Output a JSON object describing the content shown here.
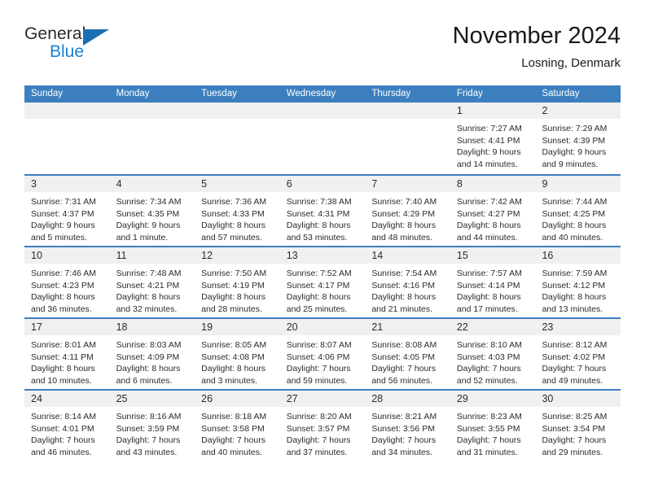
{
  "brand": {
    "name_part1": "General",
    "name_part2": "Blue"
  },
  "header": {
    "title": "November 2024",
    "subtitle": "Losning, Denmark"
  },
  "colors": {
    "header_blue": "#3c7fbe",
    "logo_blue": "#1b7fd4",
    "logo_triangle": "#1b6fb3",
    "day_band_gray": "#f0f0f0",
    "text": "#2b2b2b"
  },
  "weekdays": [
    "Sunday",
    "Monday",
    "Tuesday",
    "Wednesday",
    "Thursday",
    "Friday",
    "Saturday"
  ],
  "weeks": [
    [
      {
        "day": "",
        "lines": []
      },
      {
        "day": "",
        "lines": []
      },
      {
        "day": "",
        "lines": []
      },
      {
        "day": "",
        "lines": []
      },
      {
        "day": "",
        "lines": []
      },
      {
        "day": "1",
        "lines": [
          "Sunrise: 7:27 AM",
          "Sunset: 4:41 PM",
          "Daylight: 9 hours",
          "and 14 minutes."
        ]
      },
      {
        "day": "2",
        "lines": [
          "Sunrise: 7:29 AM",
          "Sunset: 4:39 PM",
          "Daylight: 9 hours",
          "and 9 minutes."
        ]
      }
    ],
    [
      {
        "day": "3",
        "lines": [
          "Sunrise: 7:31 AM",
          "Sunset: 4:37 PM",
          "Daylight: 9 hours",
          "and 5 minutes."
        ]
      },
      {
        "day": "4",
        "lines": [
          "Sunrise: 7:34 AM",
          "Sunset: 4:35 PM",
          "Daylight: 9 hours",
          "and 1 minute."
        ]
      },
      {
        "day": "5",
        "lines": [
          "Sunrise: 7:36 AM",
          "Sunset: 4:33 PM",
          "Daylight: 8 hours",
          "and 57 minutes."
        ]
      },
      {
        "day": "6",
        "lines": [
          "Sunrise: 7:38 AM",
          "Sunset: 4:31 PM",
          "Daylight: 8 hours",
          "and 53 minutes."
        ]
      },
      {
        "day": "7",
        "lines": [
          "Sunrise: 7:40 AM",
          "Sunset: 4:29 PM",
          "Daylight: 8 hours",
          "and 48 minutes."
        ]
      },
      {
        "day": "8",
        "lines": [
          "Sunrise: 7:42 AM",
          "Sunset: 4:27 PM",
          "Daylight: 8 hours",
          "and 44 minutes."
        ]
      },
      {
        "day": "9",
        "lines": [
          "Sunrise: 7:44 AM",
          "Sunset: 4:25 PM",
          "Daylight: 8 hours",
          "and 40 minutes."
        ]
      }
    ],
    [
      {
        "day": "10",
        "lines": [
          "Sunrise: 7:46 AM",
          "Sunset: 4:23 PM",
          "Daylight: 8 hours",
          "and 36 minutes."
        ]
      },
      {
        "day": "11",
        "lines": [
          "Sunrise: 7:48 AM",
          "Sunset: 4:21 PM",
          "Daylight: 8 hours",
          "and 32 minutes."
        ]
      },
      {
        "day": "12",
        "lines": [
          "Sunrise: 7:50 AM",
          "Sunset: 4:19 PM",
          "Daylight: 8 hours",
          "and 28 minutes."
        ]
      },
      {
        "day": "13",
        "lines": [
          "Sunrise: 7:52 AM",
          "Sunset: 4:17 PM",
          "Daylight: 8 hours",
          "and 25 minutes."
        ]
      },
      {
        "day": "14",
        "lines": [
          "Sunrise: 7:54 AM",
          "Sunset: 4:16 PM",
          "Daylight: 8 hours",
          "and 21 minutes."
        ]
      },
      {
        "day": "15",
        "lines": [
          "Sunrise: 7:57 AM",
          "Sunset: 4:14 PM",
          "Daylight: 8 hours",
          "and 17 minutes."
        ]
      },
      {
        "day": "16",
        "lines": [
          "Sunrise: 7:59 AM",
          "Sunset: 4:12 PM",
          "Daylight: 8 hours",
          "and 13 minutes."
        ]
      }
    ],
    [
      {
        "day": "17",
        "lines": [
          "Sunrise: 8:01 AM",
          "Sunset: 4:11 PM",
          "Daylight: 8 hours",
          "and 10 minutes."
        ]
      },
      {
        "day": "18",
        "lines": [
          "Sunrise: 8:03 AM",
          "Sunset: 4:09 PM",
          "Daylight: 8 hours",
          "and 6 minutes."
        ]
      },
      {
        "day": "19",
        "lines": [
          "Sunrise: 8:05 AM",
          "Sunset: 4:08 PM",
          "Daylight: 8 hours",
          "and 3 minutes."
        ]
      },
      {
        "day": "20",
        "lines": [
          "Sunrise: 8:07 AM",
          "Sunset: 4:06 PM",
          "Daylight: 7 hours",
          "and 59 minutes."
        ]
      },
      {
        "day": "21",
        "lines": [
          "Sunrise: 8:08 AM",
          "Sunset: 4:05 PM",
          "Daylight: 7 hours",
          "and 56 minutes."
        ]
      },
      {
        "day": "22",
        "lines": [
          "Sunrise: 8:10 AM",
          "Sunset: 4:03 PM",
          "Daylight: 7 hours",
          "and 52 minutes."
        ]
      },
      {
        "day": "23",
        "lines": [
          "Sunrise: 8:12 AM",
          "Sunset: 4:02 PM",
          "Daylight: 7 hours",
          "and 49 minutes."
        ]
      }
    ],
    [
      {
        "day": "24",
        "lines": [
          "Sunrise: 8:14 AM",
          "Sunset: 4:01 PM",
          "Daylight: 7 hours",
          "and 46 minutes."
        ]
      },
      {
        "day": "25",
        "lines": [
          "Sunrise: 8:16 AM",
          "Sunset: 3:59 PM",
          "Daylight: 7 hours",
          "and 43 minutes."
        ]
      },
      {
        "day": "26",
        "lines": [
          "Sunrise: 8:18 AM",
          "Sunset: 3:58 PM",
          "Daylight: 7 hours",
          "and 40 minutes."
        ]
      },
      {
        "day": "27",
        "lines": [
          "Sunrise: 8:20 AM",
          "Sunset: 3:57 PM",
          "Daylight: 7 hours",
          "and 37 minutes."
        ]
      },
      {
        "day": "28",
        "lines": [
          "Sunrise: 8:21 AM",
          "Sunset: 3:56 PM",
          "Daylight: 7 hours",
          "and 34 minutes."
        ]
      },
      {
        "day": "29",
        "lines": [
          "Sunrise: 8:23 AM",
          "Sunset: 3:55 PM",
          "Daylight: 7 hours",
          "and 31 minutes."
        ]
      },
      {
        "day": "30",
        "lines": [
          "Sunrise: 8:25 AM",
          "Sunset: 3:54 PM",
          "Daylight: 7 hours",
          "and 29 minutes."
        ]
      }
    ]
  ]
}
